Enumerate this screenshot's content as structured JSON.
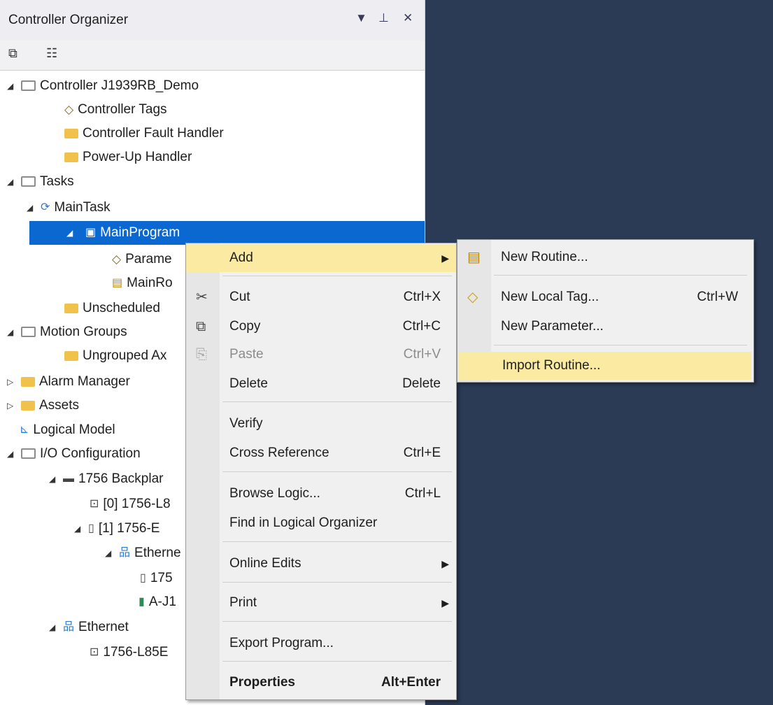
{
  "organizer": {
    "title": "Controller Organizer",
    "pin_icon": "pin-icon",
    "close_icon": "close-icon",
    "dropdown_icon": "dropdown-icon"
  },
  "tree": {
    "controller": "Controller J1939RB_Demo",
    "controller_tags": "Controller Tags",
    "fault_handler": "Controller Fault Handler",
    "powerup_handler": "Power-Up Handler",
    "tasks": "Tasks",
    "main_task": "MainTask",
    "main_program": "MainProgram",
    "parameters": "Parame",
    "main_routine": "MainRo",
    "unscheduled": "Unscheduled",
    "motion_groups": "Motion Groups",
    "ungrouped": "Ungrouped Ax",
    "alarm_manager": "Alarm Manager",
    "assets": "Assets",
    "logical_model": "Logical Model",
    "io_config": "I/O Configuration",
    "backplane": "1756 Backplar",
    "slot0": "[0] 1756-L8",
    "slot1": "[1] 1756-E",
    "ethernet_sub": "Etherne",
    "eth_dev1": "175",
    "eth_dev2": "A-J1",
    "ethernet": "Ethernet",
    "eth_ctrl": "1756-L85E"
  },
  "context_menu": {
    "add": "Add",
    "cut": "Cut",
    "cut_sc": "Ctrl+X",
    "copy": "Copy",
    "copy_sc": "Ctrl+C",
    "paste": "Paste",
    "paste_sc": "Ctrl+V",
    "delete": "Delete",
    "delete_sc": "Delete",
    "verify": "Verify",
    "cross_ref": "Cross Reference",
    "cross_ref_sc": "Ctrl+E",
    "browse_logic": "Browse Logic...",
    "browse_logic_sc": "Ctrl+L",
    "find_logical": "Find in Logical Organizer",
    "online_edits": "Online Edits",
    "print": "Print",
    "export_program": "Export Program...",
    "properties": "Properties",
    "properties_sc": "Alt+Enter"
  },
  "submenu": {
    "new_routine": "New Routine...",
    "new_local_tag": "New Local Tag...",
    "new_local_tag_sc": "Ctrl+W",
    "new_parameter": "New Parameter...",
    "import_routine": "Import Routine..."
  },
  "colors": {
    "selection": "#0a68d0",
    "highlight": "#fbeaa2",
    "background": "#2b3a55",
    "folder": "#f0c24b"
  }
}
